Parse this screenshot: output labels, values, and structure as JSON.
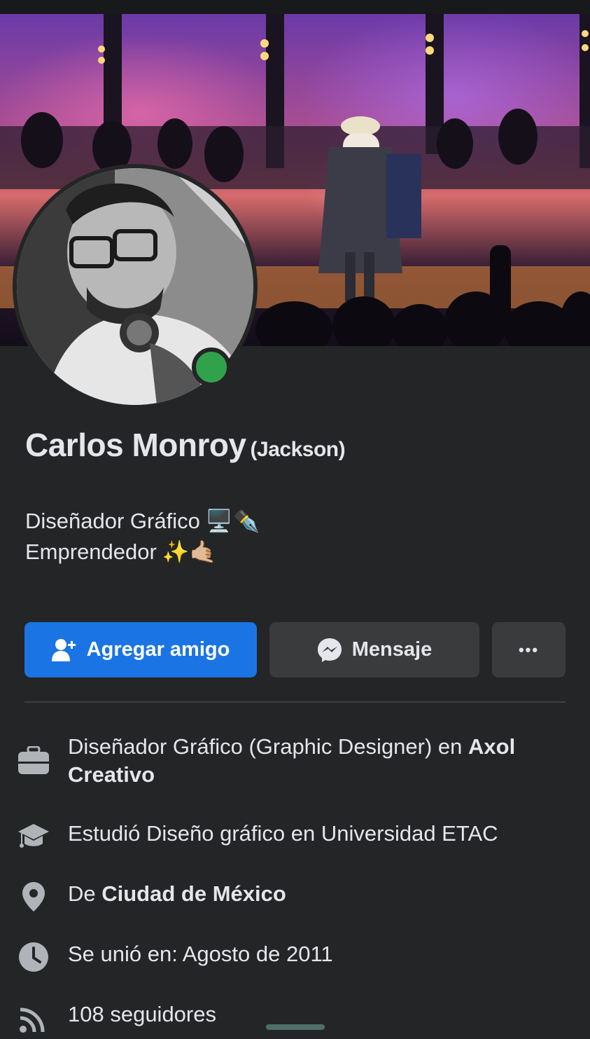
{
  "profile": {
    "name": "Carlos Monroy",
    "alternate_name": "(Jackson)",
    "bio_line1": "Diseñador Gráfico",
    "bio_line1_emoji": "🖥️✒️",
    "bio_line2": "Emprendedor",
    "bio_line2_emoji": "✨🤙🏼",
    "online_status_color": "#31a24c"
  },
  "actions": {
    "add_friend_label": "Agregar amigo",
    "message_label": "Mensaje",
    "more_label": "•••"
  },
  "details": {
    "work": {
      "text": "Diseñador Gráfico (Graphic Designer) en ",
      "place": "Axol Creativo",
      "icon": "briefcase-icon"
    },
    "education": {
      "text": "Estudió Diseño gráfico en Universidad ETAC",
      "icon": "graduation-cap-icon"
    },
    "hometown": {
      "prefix": "De ",
      "place": "Ciudad de México",
      "icon": "location-pin-icon"
    },
    "joined": {
      "text": "Se unió en: Agosto de 2011",
      "icon": "clock-icon"
    },
    "followers": {
      "text": "108 seguidores",
      "icon": "rss-icon"
    }
  },
  "colors": {
    "background": "#242526",
    "primary_button": "#1b74e4",
    "secondary_button": "#3a3b3c",
    "text": "#e4e6eb",
    "icon": "#b0b3b8"
  }
}
